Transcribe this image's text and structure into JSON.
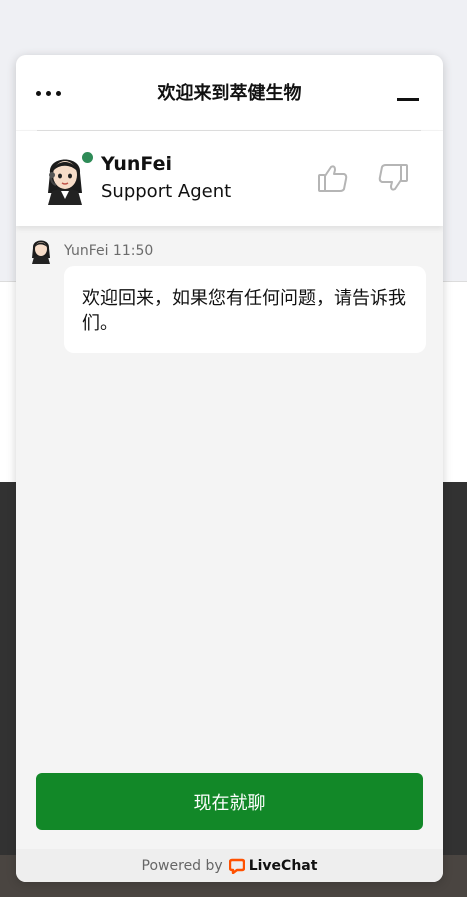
{
  "chat": {
    "title": "欢迎来到萃健生物",
    "menu_icon": "ellipsis-icon",
    "minimize_icon": "minimize-icon"
  },
  "agent": {
    "name": "YunFei",
    "role": "Support Agent",
    "status": "online",
    "status_color": "#2e8b57"
  },
  "message": {
    "author": "YunFei",
    "time": "11:50",
    "meta": "YunFei 11:50",
    "text": "欢迎回来，如果您有任何问题，请告诉我们。"
  },
  "cta": {
    "label": "现在就聊",
    "color": "#128828"
  },
  "footer": {
    "powered_by": "Powered by",
    "brand": "LiveChat",
    "brand_color": "#ff5100"
  }
}
